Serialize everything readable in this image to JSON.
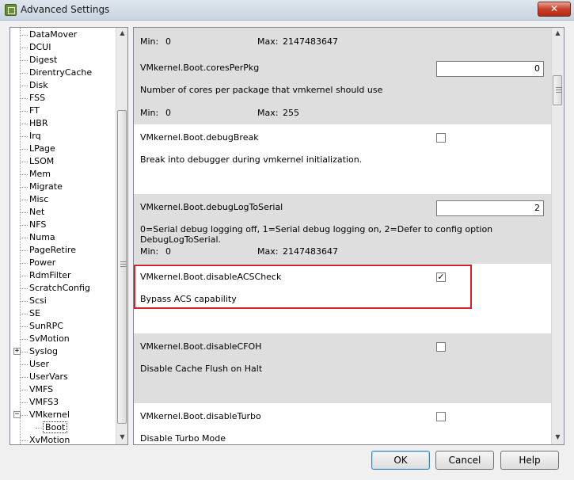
{
  "window": {
    "title": "Advanced Settings",
    "close_label": "✕"
  },
  "tree": {
    "items": [
      {
        "label": "DataMover"
      },
      {
        "label": "DCUI"
      },
      {
        "label": "Digest"
      },
      {
        "label": "DirentryCache"
      },
      {
        "label": "Disk"
      },
      {
        "label": "FSS"
      },
      {
        "label": "FT"
      },
      {
        "label": "HBR"
      },
      {
        "label": "Irq"
      },
      {
        "label": "LPage"
      },
      {
        "label": "LSOM"
      },
      {
        "label": "Mem"
      },
      {
        "label": "Migrate"
      },
      {
        "label": "Misc"
      },
      {
        "label": "Net"
      },
      {
        "label": "NFS"
      },
      {
        "label": "Numa"
      },
      {
        "label": "PageRetire"
      },
      {
        "label": "Power"
      },
      {
        "label": "RdmFilter"
      },
      {
        "label": "ScratchConfig"
      },
      {
        "label": "Scsi"
      },
      {
        "label": "SE"
      },
      {
        "label": "SunRPC"
      },
      {
        "label": "SvMotion"
      },
      {
        "label": "Syslog",
        "expander": "+"
      },
      {
        "label": "User"
      },
      {
        "label": "UserVars"
      },
      {
        "label": "VMFS"
      },
      {
        "label": "VMFS3"
      },
      {
        "label": "VMkernel",
        "expander": "−"
      },
      {
        "label": "Boot",
        "child": true,
        "selected": true
      },
      {
        "label": "XvMotion"
      }
    ]
  },
  "settings": {
    "first_minmax": {
      "min_label": "Min:",
      "min": "0",
      "max_label": "Max:",
      "max": "2147483647"
    },
    "items": [
      {
        "name": "VMkernel.Boot.coresPerPkg",
        "description": "Number of cores per package that vmkernel should use",
        "type": "number",
        "value": "0",
        "min_label": "Min:",
        "min": "0",
        "max_label": "Max:",
        "max": "255"
      },
      {
        "name": "VMkernel.Boot.debugBreak",
        "description": "Break into debugger during vmkernel initialization.",
        "type": "checkbox",
        "checked": false
      },
      {
        "name": "VMkernel.Boot.debugLogToSerial",
        "description": "0=Serial debug logging off, 1=Serial debug logging on, 2=Defer to config option DebugLogToSerial.",
        "type": "number",
        "value": "2",
        "min_label": "Min:",
        "min": "0",
        "max_label": "Max:",
        "max": "2147483647"
      },
      {
        "name": "VMkernel.Boot.disableACSCheck",
        "description": "Bypass ACS capability",
        "type": "checkbox",
        "checked": true,
        "check_mark": "✓"
      },
      {
        "name": "VMkernel.Boot.disableCFOH",
        "description": "Disable Cache Flush on Halt",
        "type": "checkbox",
        "checked": false
      },
      {
        "name": "VMkernel.Boot.disableTurbo",
        "description": "Disable Turbo Mode",
        "type": "checkbox",
        "checked": false
      }
    ]
  },
  "buttons": {
    "ok": "OK",
    "cancel": "Cancel",
    "help": "Help"
  },
  "colors": {
    "highlight": "#d2232a",
    "grey_row": "#dedede"
  }
}
